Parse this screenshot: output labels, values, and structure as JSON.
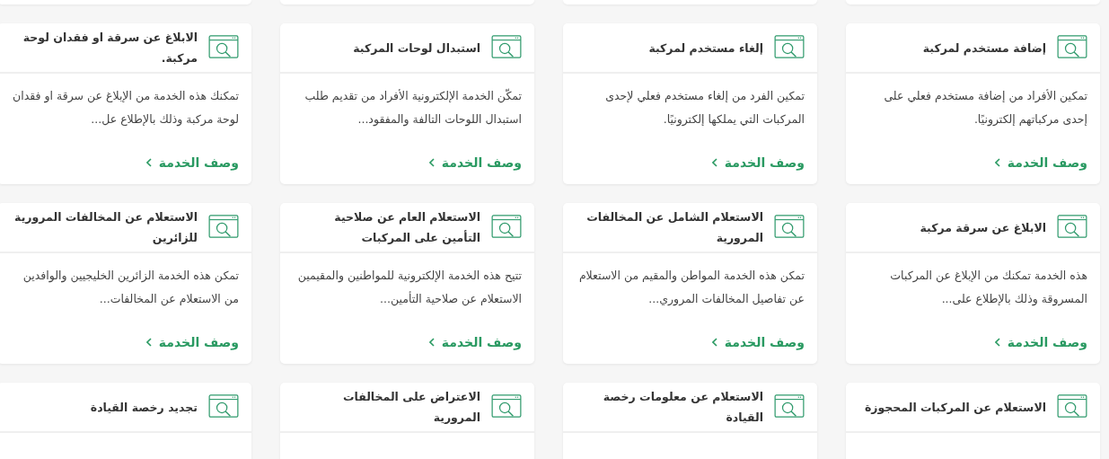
{
  "services": [
    {
      "title": "إضافة مستخدم لمركبة",
      "description": "تمكين الأفراد من إضافة مستخدم فعلي على إحدى مركباتهم إلكترونيًا.",
      "link": "وصف الخدمة"
    },
    {
      "title": "إلغاء مستخدم لمركبة",
      "description": "تمكين الفرد من إلغاء مستخدم فعلي لإحدى المركبات التي يملكها إلكترونيًا.",
      "link": "وصف الخدمة"
    },
    {
      "title": "استبدال لوحات المركبة",
      "description": "تمكّن الخدمة الإلكترونية الأفراد من تقديم طلب استبدال اللوحات التالفة والمفقود...",
      "link": "وصف الخدمة"
    },
    {
      "title": "الابلاغ عن سرقة او فقدان لوحة مركبة.",
      "description": "تمكنك هذه الخدمة من الإبلاغ عن سرقة او فقدان لوحة مركبة وذلك بالإطلاع عل...",
      "link": "وصف الخدمة"
    },
    {
      "title": "الابلاغ عن سرقة مركبة",
      "description": "هذه الخدمة تمكنك من الإبلاغ عن المركبات المسروقة وذلك بالإطلاع على...",
      "link": "وصف الخدمة"
    },
    {
      "title": "الاستعلام الشامل عن المخالفات المرورية",
      "description": "تمكن هذه الخدمة المواطن والمقيم من الاستعلام عن تفاصيل المخالفات المروري...",
      "link": "وصف الخدمة"
    },
    {
      "title": "الاستعلام العام عن صلاحية التأمين على المركبات",
      "description": "تتيح هذه الخدمة الإلكترونية للمواطنين والمقيمين الاستعلام عن صلاحية التأمين...",
      "link": "وصف الخدمة"
    },
    {
      "title": "الاستعلام عن المخالفات المرورية للزائرين",
      "description": "تمكن هذه الخدمة الزائرين الخليجيين والوافدين من الاستعلام عن المخالفات...",
      "link": "وصف الخدمة"
    },
    {
      "title": "الاستعلام عن المركبات المحجوزة"
    },
    {
      "title": "الاستعلام عن معلومات رخصة القيادة"
    },
    {
      "title": "الاعتراض على المخالفات المرورية"
    },
    {
      "title": "تجديد رخصة القيادة"
    }
  ]
}
